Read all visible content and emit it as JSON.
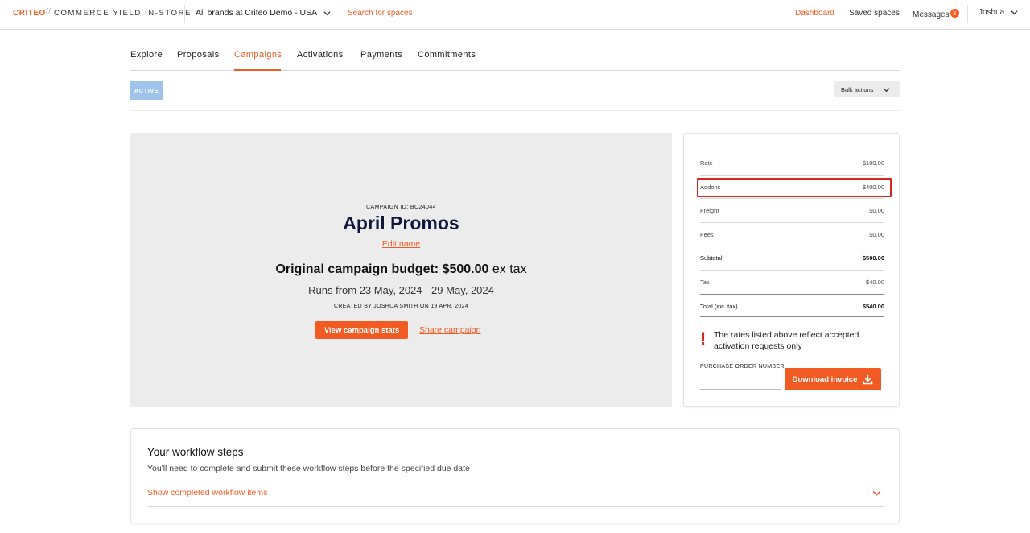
{
  "topbar": {
    "logo": "CRITEO",
    "logo_separator": "//",
    "product": "COMMERCE YIELD IN-STORE",
    "brand_select": "All brands at Criteo Demo - USA",
    "search_link": "Search for spaces",
    "nav": {
      "dashboard": "Dashboard",
      "saved_spaces": "Saved spaces",
      "messages": "Messages",
      "messages_count": "3"
    },
    "user": "Joshua"
  },
  "tabs": [
    {
      "label": "Explore"
    },
    {
      "label": "Proposals"
    },
    {
      "label": "Campaigns"
    },
    {
      "label": "Activations"
    },
    {
      "label": "Payments"
    },
    {
      "label": "Commitments"
    }
  ],
  "active_tab": "Campaigns",
  "status_badge": "ACTIVE",
  "bulk_actions": "Bulk actions",
  "campaign": {
    "id_label": "CAMPAIGN ID: BC24044",
    "title": "April Promos",
    "edit_name": "Edit name",
    "budget_label": "Original campaign budget:",
    "budget_value": "$500.00",
    "budget_suffix": "ex tax",
    "runs": "Runs from 23 May, 2024 - 29 May, 2024",
    "created": "CREATED BY JOSHUA SMITH ON 19 APR, 2024",
    "view_stats": "View campaign stats",
    "share": "Share campaign"
  },
  "summary": {
    "rows": [
      {
        "label": "Rate",
        "value": "$100.00"
      },
      {
        "label": "Addons",
        "value": "$400.00"
      },
      {
        "label": "Freight",
        "value": "$0.00"
      },
      {
        "label": "Fees",
        "value": "$0.00"
      },
      {
        "label": "Subtotal",
        "value": "$500.00"
      },
      {
        "label": "Tax",
        "value": "$40.00"
      },
      {
        "label": "Total (inc. tax)",
        "value": "$540.00"
      }
    ],
    "warning": "The rates listed above reflect accepted activation requests only",
    "po_label": "PURCHASE ORDER NUMBER",
    "po_value": "",
    "download": "Download invoice"
  },
  "workflow": {
    "title": "Your workflow steps",
    "subtitle": "You'll need to complete and submit these workflow steps before the specified due date",
    "toggle": "Show completed workflow items"
  },
  "colors": {
    "accent": "#f15a22",
    "active_badge": "#9ec4ec",
    "highlight": "#d6261d",
    "title": "#10163d"
  }
}
